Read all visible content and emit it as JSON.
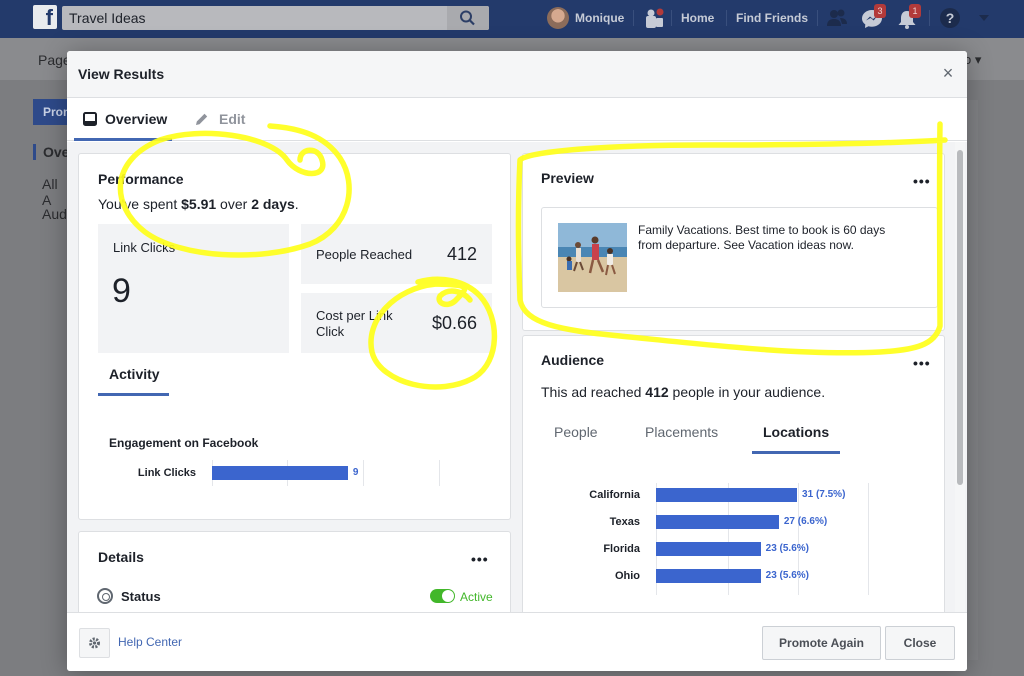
{
  "topbar": {
    "search_value": "Travel Ideas",
    "user_name": "Monique",
    "home": "Home",
    "find_friends": "Find Friends",
    "messages_badge": "3",
    "notifications_badge": "1",
    "help_glyph": "?"
  },
  "background_page": {
    "pages_link": "Page",
    "sub_right": "o",
    "promote": "Prom",
    "sidebar": [
      "Ove",
      "All A",
      "Aud"
    ]
  },
  "modal": {
    "title": "View Results",
    "tabs": {
      "overview": "Overview",
      "edit": "Edit"
    },
    "performance": {
      "title": "Performance",
      "spent_prefix": "You've spent ",
      "spent_amount": "$5.91",
      "spent_middle": " over ",
      "spent_days": "2 days",
      "spent_suffix": ".",
      "link_clicks_label": "Link Clicks",
      "link_clicks_value": "9",
      "people_reached_label": "People Reached",
      "people_reached_value": "412",
      "cost_per_click_label": "Cost per Link Click",
      "cost_per_click_value": "$0.66",
      "activity_tab": "Activity",
      "engagement_title": "Engagement on Facebook",
      "engagement_chart": {
        "labels": [
          "Link Clicks"
        ],
        "values": [
          9
        ],
        "value_labels": [
          "9"
        ]
      }
    },
    "details": {
      "title": "Details",
      "status_label": "Status",
      "status_value": "Active"
    },
    "preview": {
      "title": "Preview",
      "ad_text": "Family Vacations. Best time to book is 60 days from departure. See Vacation ideas now."
    },
    "audience": {
      "title": "Audience",
      "reached_prefix": "This ad reached ",
      "reached_count": "412",
      "reached_suffix": " people in your audience.",
      "tabs": [
        "People",
        "Placements",
        "Locations"
      ],
      "active_tab": "Locations",
      "locations_chart": {
        "labels": [
          "California",
          "Texas",
          "Florida",
          "Ohio"
        ],
        "values": [
          31,
          27,
          23,
          23
        ],
        "value_labels": [
          "31 (7.5%)",
          "27 (6.6%)",
          "23 (5.6%)",
          "23 (5.6%)"
        ]
      }
    },
    "footer": {
      "help_center": "Help Center",
      "promote_again": "Promote Again",
      "close": "Close"
    }
  },
  "colors": {
    "accent": "#4267b2",
    "bar": "#3b65ce",
    "highlighter": "#ffff1a",
    "active_green": "#42b72a"
  }
}
